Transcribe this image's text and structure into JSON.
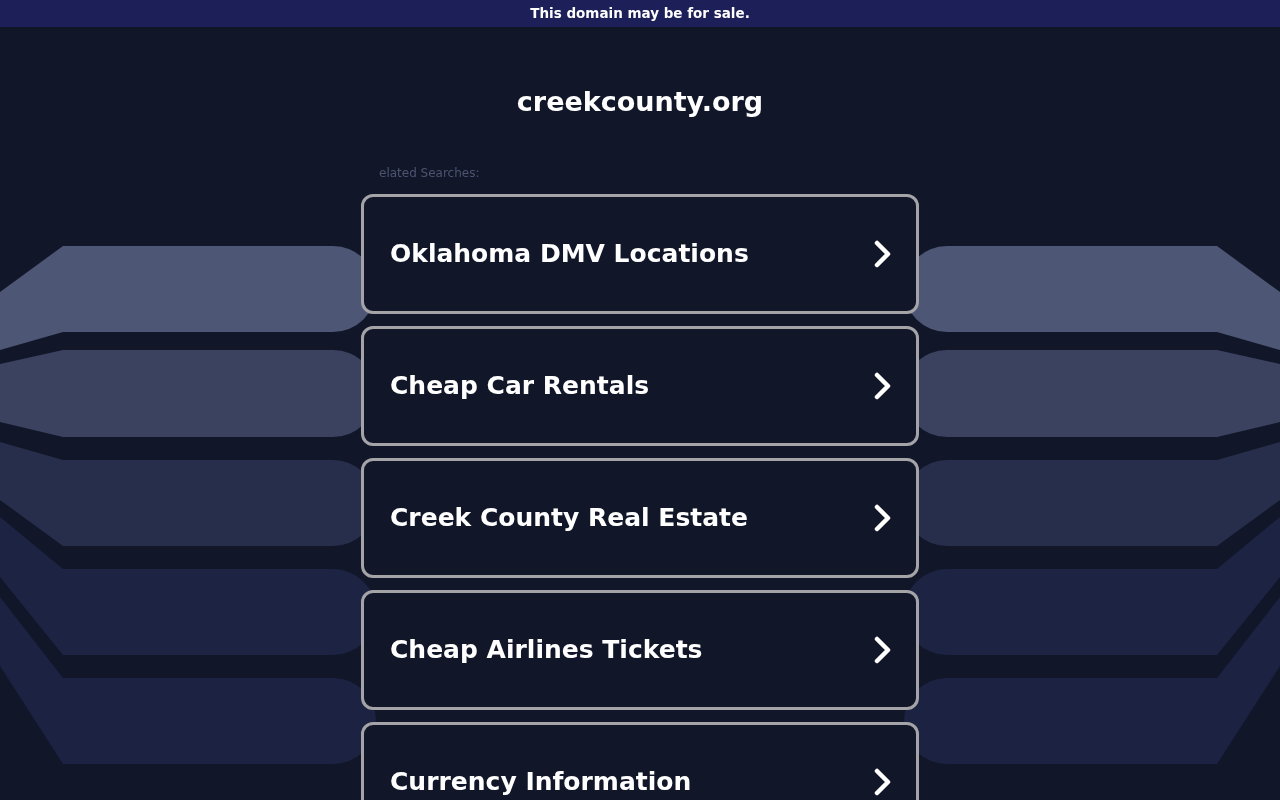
{
  "banner": {
    "text": "This domain may be for sale."
  },
  "title": "creekcounty.org",
  "related": {
    "heading": "elated Searches:",
    "links": [
      {
        "label": "Oklahoma DMV Locations"
      },
      {
        "label": "Cheap Car Rentals"
      },
      {
        "label": "Creek County Real Estate"
      },
      {
        "label": "Cheap Airlines Tickets"
      },
      {
        "label": "Currency Information"
      }
    ]
  }
}
